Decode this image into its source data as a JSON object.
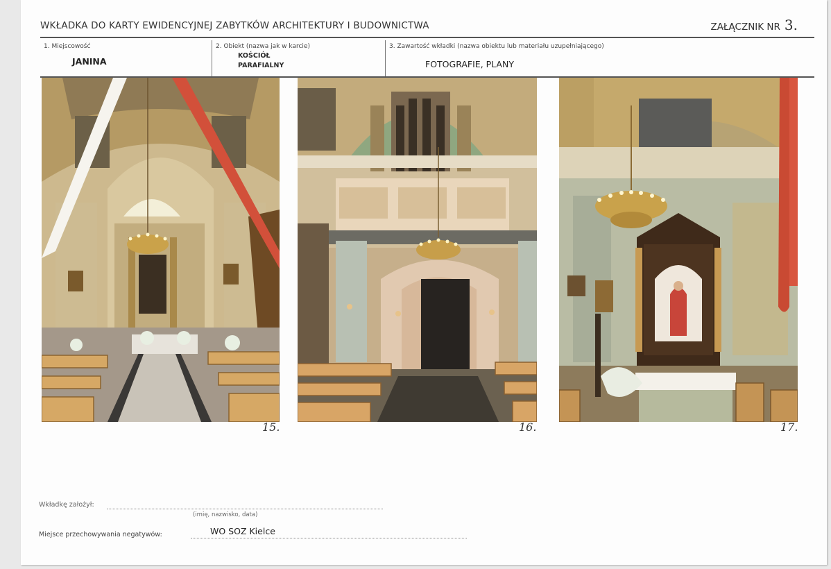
{
  "header": {
    "title": "WKŁADKA DO KARTY EWIDENCYJNEJ ZABYTKÓW   ARCHITEKTURY I BUDOWNICTWA",
    "annex_label": "ZAŁĄCZNIK NR",
    "annex_number": "3."
  },
  "fields": {
    "locality": {
      "label": "1. Miejscowość",
      "value": "JANINA"
    },
    "object": {
      "label": "2. Obiekt (nazwa jak w karcie)",
      "value_line1": "KOŚCIÓŁ",
      "value_line2": "PARAFIALNY"
    },
    "content": {
      "label": "3. Zawartość wkładki (nazwa obiektu lub materiału uzupełniającego)",
      "value": "FOTOGRAFIE, PLANY"
    }
  },
  "photos": [
    {
      "number": "15.",
      "icon": "church-nave-altar-photo"
    },
    {
      "number": "16.",
      "icon": "church-organ-loft-photo"
    },
    {
      "number": "17.",
      "icon": "church-side-altar-photo"
    }
  ],
  "footer": {
    "made_by_label": "Wkładkę założył:",
    "made_by_hint": "(imię, nazwisko, data)",
    "storage_label": "Miejsce przechowywania negatywów:",
    "storage_value": "WO SOZ Kielce"
  }
}
